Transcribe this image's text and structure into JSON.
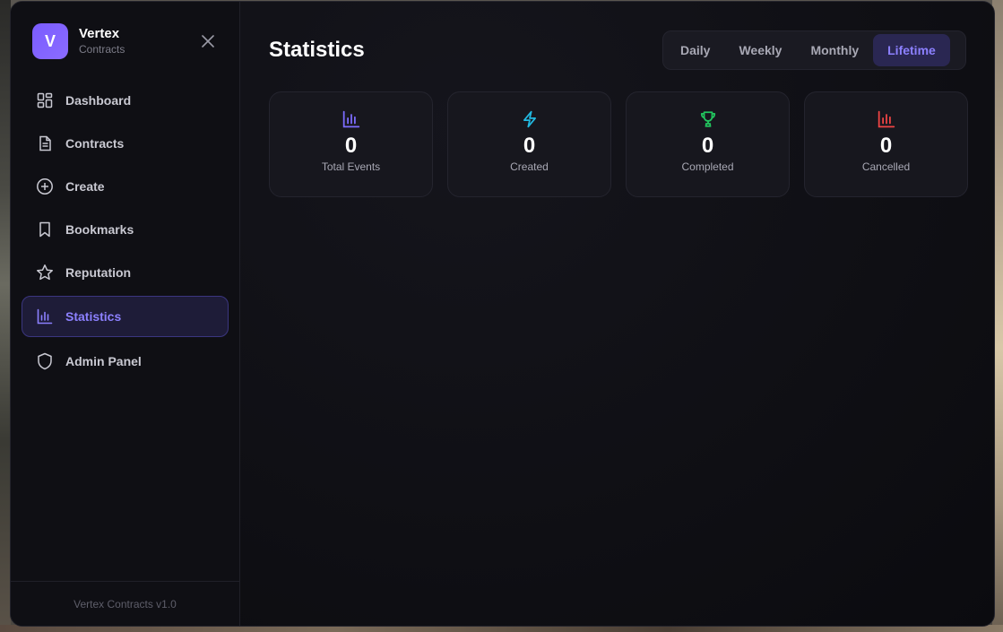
{
  "brand": {
    "logo_letter": "V",
    "name": "Vertex",
    "subtitle": "Contracts"
  },
  "sidebar": {
    "items": [
      {
        "label": "Dashboard",
        "icon": "grid-icon",
        "active": false
      },
      {
        "label": "Contracts",
        "icon": "document-icon",
        "active": false
      },
      {
        "label": "Create",
        "icon": "plus-circle-icon",
        "active": false
      },
      {
        "label": "Bookmarks",
        "icon": "bookmark-icon",
        "active": false
      },
      {
        "label": "Reputation",
        "icon": "star-icon",
        "active": false
      },
      {
        "label": "Statistics",
        "icon": "bar-chart-icon",
        "active": true
      },
      {
        "label": "Admin Panel",
        "icon": "shield-icon",
        "active": false
      }
    ],
    "footer": "Vertex Contracts v1.0"
  },
  "main": {
    "title": "Statistics",
    "period_tabs": [
      {
        "label": "Daily",
        "active": false
      },
      {
        "label": "Weekly",
        "active": false
      },
      {
        "label": "Monthly",
        "active": false
      },
      {
        "label": "Lifetime",
        "active": true
      }
    ],
    "stats": [
      {
        "value": "0",
        "label": "Total Events",
        "icon": "bar-chart-icon",
        "color": "#7c6cff"
      },
      {
        "value": "0",
        "label": "Created",
        "icon": "lightning-icon",
        "color": "#22b8e0"
      },
      {
        "value": "0",
        "label": "Completed",
        "icon": "trophy-icon",
        "color": "#22c55e"
      },
      {
        "value": "0",
        "label": "Cancelled",
        "icon": "bar-chart-icon",
        "color": "#ef4444"
      }
    ]
  },
  "colors": {
    "accent": "#8c80ff",
    "background": "#0e0e12"
  }
}
